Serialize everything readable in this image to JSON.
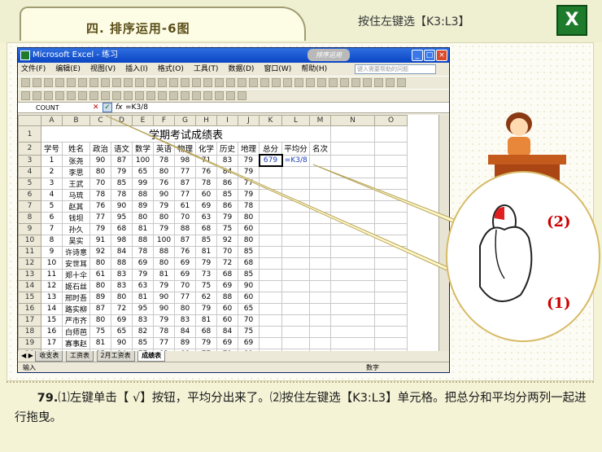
{
  "header": {
    "section_title": "四. 排序运用-6图",
    "hint": "按住左键选【K3:L3】",
    "logo_letter": "X"
  },
  "excel": {
    "window_title": "Microsoft Excel - 练习",
    "title_badge": "排序运用",
    "menus": [
      "文件(F)",
      "编辑(E)",
      "视图(V)",
      "插入(I)",
      "格式(O)",
      "工具(T)",
      "数据(D)",
      "窗口(W)",
      "帮助(H)"
    ],
    "help_placeholder": "键入需要帮助的问题",
    "name_box": "COUNT",
    "formula": "=K3/8",
    "sheet_tabs": [
      "收支表",
      "工资表",
      "2月工资表",
      "成绩表"
    ],
    "status_left": "输入",
    "status_right": "数字",
    "columns": [
      "A",
      "B",
      "C",
      "D",
      "E",
      "F",
      "G",
      "H",
      "I",
      "J",
      "K",
      "L",
      "M",
      "N",
      "O"
    ],
    "sheet_title": "学期考试成绩表",
    "headers": [
      "学号",
      "姓名",
      "政治",
      "语文",
      "数学",
      "英语",
      "物理",
      "化学",
      "历史",
      "地理",
      "总分",
      "平均分",
      "名次"
    ],
    "rows": [
      [
        "1",
        "张尧",
        "90",
        "87",
        "100",
        "78",
        "98",
        "71",
        "83",
        "79",
        "679",
        "=K3/8",
        ""
      ],
      [
        "2",
        "李思",
        "80",
        "79",
        "65",
        "80",
        "77",
        "76",
        "84",
        "79",
        "",
        "",
        ""
      ],
      [
        "3",
        "王武",
        "70",
        "85",
        "99",
        "76",
        "87",
        "78",
        "86",
        "77",
        "",
        "",
        ""
      ],
      [
        "4",
        "马琉",
        "78",
        "78",
        "88",
        "90",
        "77",
        "60",
        "85",
        "79",
        "",
        "",
        ""
      ],
      [
        "5",
        "赵其",
        "76",
        "90",
        "89",
        "79",
        "61",
        "69",
        "86",
        "78",
        "",
        "",
        ""
      ],
      [
        "6",
        "钱坝",
        "77",
        "95",
        "80",
        "80",
        "70",
        "63",
        "79",
        "80",
        "",
        "",
        ""
      ],
      [
        "7",
        "孙久",
        "79",
        "68",
        "81",
        "79",
        "88",
        "68",
        "75",
        "60",
        "",
        "",
        ""
      ],
      [
        "8",
        "吴实",
        "91",
        "98",
        "88",
        "100",
        "87",
        "85",
        "92",
        "80",
        "",
        "",
        ""
      ],
      [
        "9",
        "许诗意",
        "92",
        "84",
        "78",
        "88",
        "76",
        "81",
        "70",
        "85",
        "",
        "",
        ""
      ],
      [
        "10",
        "安世耳",
        "80",
        "88",
        "69",
        "80",
        "69",
        "79",
        "72",
        "68",
        "",
        "",
        ""
      ],
      [
        "11",
        "郑十伞",
        "61",
        "83",
        "79",
        "81",
        "69",
        "73",
        "68",
        "85",
        "",
        "",
        ""
      ],
      [
        "12",
        "姬石丝",
        "80",
        "83",
        "63",
        "79",
        "70",
        "75",
        "69",
        "90",
        "",
        "",
        ""
      ],
      [
        "13",
        "邢时吾",
        "89",
        "80",
        "81",
        "90",
        "77",
        "62",
        "88",
        "60",
        "",
        "",
        ""
      ],
      [
        "14",
        "路实柳",
        "87",
        "72",
        "95",
        "90",
        "80",
        "79",
        "60",
        "65",
        "",
        "",
        ""
      ],
      [
        "15",
        "严市齐",
        "80",
        "69",
        "83",
        "79",
        "83",
        "81",
        "60",
        "70",
        "",
        "",
        ""
      ],
      [
        "16",
        "白师芭",
        "75",
        "65",
        "82",
        "78",
        "84",
        "68",
        "84",
        "75",
        "",
        "",
        ""
      ],
      [
        "17",
        "寡事赵",
        "81",
        "90",
        "85",
        "77",
        "89",
        "79",
        "69",
        "69",
        "",
        "",
        ""
      ],
      [
        "18",
        "贾尔时",
        "85",
        "84",
        "77",
        "82",
        "68",
        "77",
        "71",
        "81",
        "",
        "",
        ""
      ]
    ]
  },
  "callout": {
    "label1": "(1)",
    "label2": "(2)"
  },
  "caption": {
    "step_no": "79.",
    "text": "⑴左键单击【 √】按钮，平均分出来了。⑵按住左键选【K3:L3】单元格。把总分和平均分两列一起进行拖曳。"
  }
}
